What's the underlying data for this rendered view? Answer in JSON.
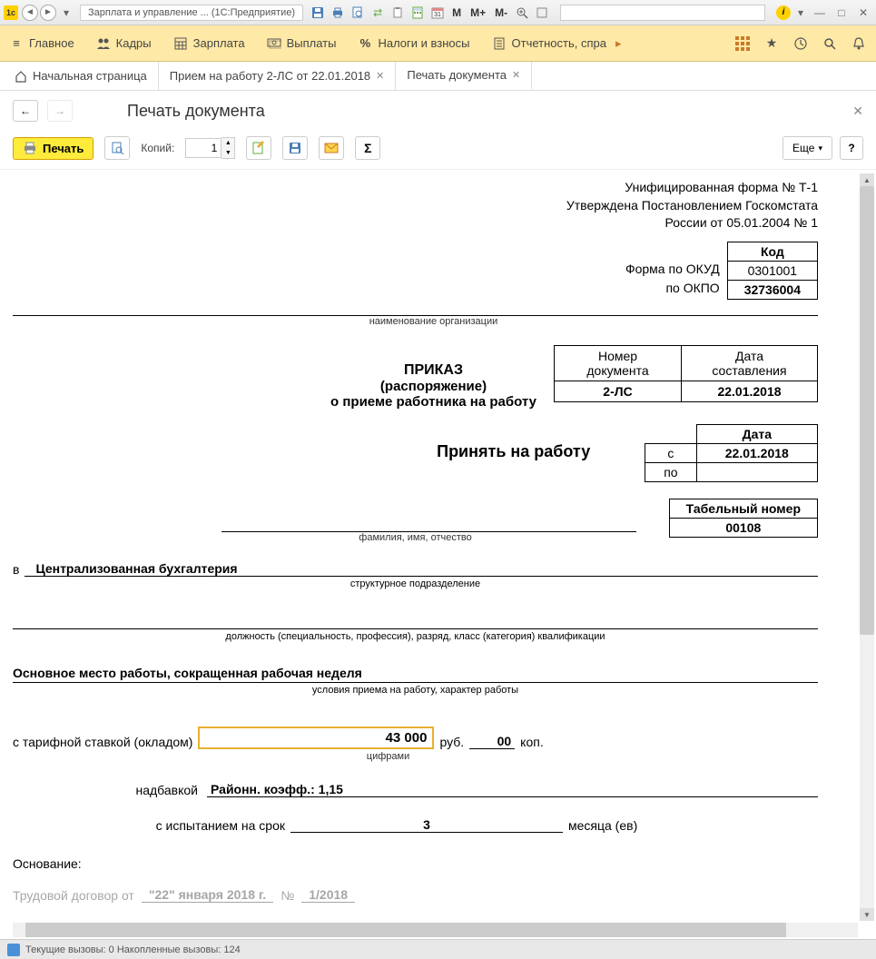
{
  "titlebar": {
    "logo": "1c",
    "title": "Зарплата и управление ...  (1С:Предприятие)",
    "m_buttons": [
      "M",
      "M+",
      "M-"
    ]
  },
  "toolbar": {
    "items": [
      {
        "icon": "menu",
        "label": "Главное"
      },
      {
        "icon": "people",
        "label": "Кадры"
      },
      {
        "icon": "calc",
        "label": "Зарплата"
      },
      {
        "icon": "money",
        "label": "Выплаты"
      },
      {
        "icon": "percent",
        "label": "Налоги и взносы"
      },
      {
        "icon": "report",
        "label": "Отчетность, спра"
      }
    ]
  },
  "tabs": [
    {
      "label": "Начальная страница",
      "closable": false,
      "icon": "home"
    },
    {
      "label": "Прием на работу 2-ЛС от 22.01.2018",
      "closable": true
    },
    {
      "label": "Печать документа",
      "closable": true,
      "active": true
    }
  ],
  "page": {
    "title": "Печать документа",
    "print_btn": "Печать",
    "copies_label": "Копий:",
    "copies_value": "1",
    "more_btn": "Еще",
    "help_btn": "?"
  },
  "doc": {
    "form_name": "Унифицированная форма № Т-1",
    "approved": "Утверждена Постановлением Госкомстата",
    "approved2": "России от 05.01.2004 № 1",
    "code_hdr": "Код",
    "okud_label": "Форма по ОКУД",
    "okud": "0301001",
    "okpo_label": "по ОКПО",
    "okpo": "32736004",
    "org_hint": "наименование организации",
    "docnum_hdr": "Номер документа",
    "docdate_hdr": "Дата составления",
    "docnum": "2-ЛС",
    "docdate": "22.01.2018",
    "order": "ПРИКАЗ",
    "order_sub1": "(распоряжение)",
    "order_sub2": "о приеме работника на работу",
    "accept": "Принять на работу",
    "date_hdr": "Дата",
    "date_from_lbl": "с",
    "date_from": "22.01.2018",
    "date_to_lbl": "по",
    "date_to": "",
    "tabel_hdr": "Табельный номер",
    "tabel": "00108",
    "fio_hint": "фамилия, имя, отчество",
    "in_label": "в",
    "dept": "Централизованная бухгалтерия",
    "dept_hint": "структурное подразделение",
    "pos_hint": "должность (специальность, профессия), разряд, класс (категория) квалификации",
    "work_cond": "Основное место работы, сокращенная рабочая неделя",
    "work_cond_hint": "условия приема на работу, характер работы",
    "salary_label": "с тарифной ставкой (окладом)",
    "salary": "43 000",
    "salary_rub": "руб.",
    "salary_kop": "00",
    "salary_kop_lbl": "коп.",
    "salary_hint": "цифрами",
    "allowance_label": "надбавкой",
    "allowance": "Районн. коэфф.: 1,15",
    "probation_label": "с испытанием на срок",
    "probation": "3",
    "probation_unit": "месяца (ев)",
    "basis": "Основание:",
    "contract_label": "Трудовой договор от",
    "contract_date": "\"22\" января 2018 г.",
    "contract_num_lbl": "№",
    "contract_num": "1/2018"
  },
  "statusbar": {
    "text": "Текущие вызовы: 0  Накопленные вызовы: 124"
  }
}
